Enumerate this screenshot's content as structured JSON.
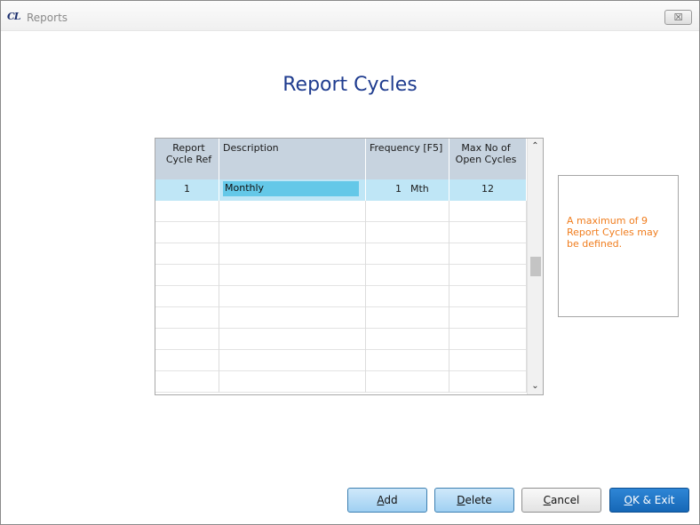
{
  "window": {
    "logo": "CL",
    "title": "Reports",
    "close_glyph": "☒"
  },
  "page_title": "Report Cycles",
  "grid": {
    "headers": [
      "Report Cycle Ref",
      "Description",
      "Frequency [F5]",
      "Max No of Open Cycles"
    ],
    "rows": [
      {
        "ref": "1",
        "description": "Monthly",
        "frequency_value": "1",
        "frequency_unit": "Mth",
        "max_open": "12"
      }
    ],
    "empty_row_count": 9,
    "scroll_up_glyph": "⌃",
    "scroll_down_glyph": "⌄"
  },
  "info_message": "A maximum of 9 Report Cycles may be defined.",
  "buttons": {
    "add": {
      "mnemonic": "A",
      "rest": "dd"
    },
    "delete": {
      "mnemonic": "D",
      "rest": "elete"
    },
    "cancel": {
      "mnemonic": "C",
      "rest": "ancel"
    },
    "ok_exit": {
      "mnemonic": "O",
      "rest": "K & Exit"
    }
  },
  "colors": {
    "title_blue": "#1f3c8f",
    "info_orange": "#f07d1e",
    "selected_row": "#bfe6f6",
    "edit_highlight": "#64c8e8",
    "header_bg": "#c7d3df",
    "ok_button": "#1667b6"
  }
}
